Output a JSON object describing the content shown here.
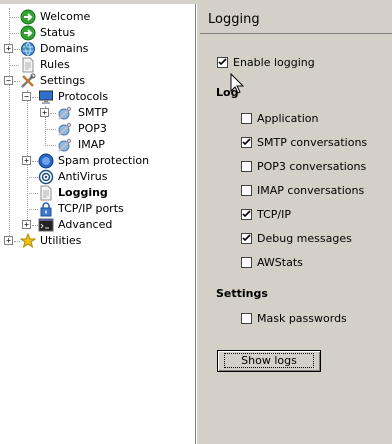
{
  "tree": {
    "items": [
      {
        "label": "Welcome",
        "icon": "green-arrow-icon"
      },
      {
        "label": "Status",
        "icon": "green-arrow-icon"
      },
      {
        "label": "Domains",
        "icon": "globe-icon"
      },
      {
        "label": "Rules",
        "icon": "document-icon"
      },
      {
        "label": "Settings",
        "icon": "tools-icon"
      },
      {
        "label": "Protocols",
        "icon": "monitor-icon"
      },
      {
        "label": "SMTP",
        "icon": "protocol-icon"
      },
      {
        "label": "POP3",
        "icon": "protocol-icon"
      },
      {
        "label": "IMAP",
        "icon": "protocol-icon"
      },
      {
        "label": "Spam protection",
        "icon": "blue-circle-icon"
      },
      {
        "label": "AntiVirus",
        "icon": "target-icon"
      },
      {
        "label": "Logging",
        "icon": "document-icon"
      },
      {
        "label": "TCP/IP ports",
        "icon": "lock-icon"
      },
      {
        "label": "Advanced",
        "icon": "console-icon"
      },
      {
        "label": "Utilities",
        "icon": "star-icon"
      }
    ]
  },
  "panel": {
    "title": "Logging",
    "enable_logging": {
      "label": "Enable logging",
      "checked": true
    },
    "log_section": "Log",
    "log_options": [
      {
        "label": "Application",
        "checked": false
      },
      {
        "label": "SMTP conversations",
        "checked": true
      },
      {
        "label": "POP3 conversations",
        "checked": false
      },
      {
        "label": "IMAP conversations",
        "checked": false
      },
      {
        "label": "TCP/IP",
        "checked": true
      },
      {
        "label": "Debug messages",
        "checked": true
      },
      {
        "label": "AWStats",
        "checked": false
      }
    ],
    "settings_section": "Settings",
    "mask_passwords": {
      "label": "Mask passwords",
      "checked": false
    },
    "show_logs_label": "Show logs"
  }
}
